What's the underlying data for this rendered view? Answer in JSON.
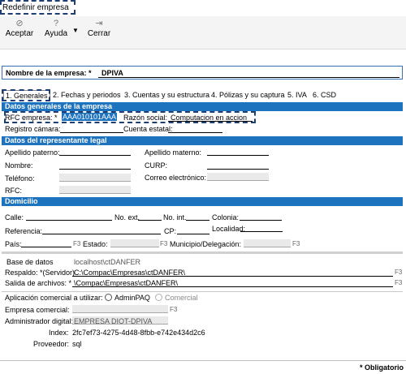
{
  "window": {
    "title": "Redefinir empresa"
  },
  "toolbar": {
    "accept_label": "Aceptar",
    "help_label": "Ayuda",
    "close_label": "Cerrar"
  },
  "company": {
    "name_label": "Nombre de la empresa: *",
    "name_value": "DPIVA"
  },
  "tabs": [
    {
      "label": "1. Generales"
    },
    {
      "label": "2. Fechas y periodos"
    },
    {
      "label": "3. Cuentas y su estructura"
    },
    {
      "label": "4. Pólizas y su captura"
    },
    {
      "label": "5. IVA"
    },
    {
      "label": "6. CSD"
    }
  ],
  "general": {
    "section_title": "Datos generales de la empresa",
    "rfc_label": "RFC empresa: *",
    "rfc_value": "AAA010101AAA",
    "razon_label": "Razón social:",
    "razon_value": "Computacion en accion",
    "registro_label": "Registro cámara:",
    "cuenta_label": "Cuenta estatal:"
  },
  "legal": {
    "section_title": "Datos del representante legal",
    "apellido_paterno": "Apellido paterno:",
    "apellido_materno": "Apellido materno:",
    "nombre": "Nombre:",
    "curp": "CURP:",
    "telefono": "Teléfono:",
    "correo": "Correo electrónico:",
    "rfc": "RFC:"
  },
  "domicilio": {
    "section_title": "Domicilio",
    "calle": "Calle:",
    "no_ext": "No. ext.",
    "no_int": "No. int.",
    "colonia": "Colonia:",
    "referencia": "Referencia:",
    "cp": "CP:",
    "localidad": "Localidad:",
    "pais": "País:",
    "estado": "Estado:",
    "municipio": "Municipio/Delegación:",
    "f3": "F3"
  },
  "database": {
    "base_label": "Base de datos",
    "base_value": "localhost\\ctDANFER",
    "respaldo_label": "Respaldo: *(Servidor)",
    "respaldo_value": "C:\\Compac\\Empresas\\ctDANFER\\",
    "salida_label": "Salida de archivos: *",
    "salida_value": "\\Compac\\Empresas\\ctDANFER\\"
  },
  "commercial": {
    "app_label": "Aplicación comercial a utilizar:",
    "option1": "AdminPAQ",
    "option2": "Comercial",
    "empresa_label": "Empresa comercial:",
    "admin_label": "Administrador digital:",
    "admin_value": "EMPRESA DIOT-DPIVA",
    "index_label": "Index:",
    "index_value": "2fc7ef73-4275-4d48-8fbb-e742e434d2c6",
    "proveedor_label": "Proveedor:",
    "proveedor_value": "sql"
  },
  "footer": {
    "required_note": "* Obligatorio"
  }
}
